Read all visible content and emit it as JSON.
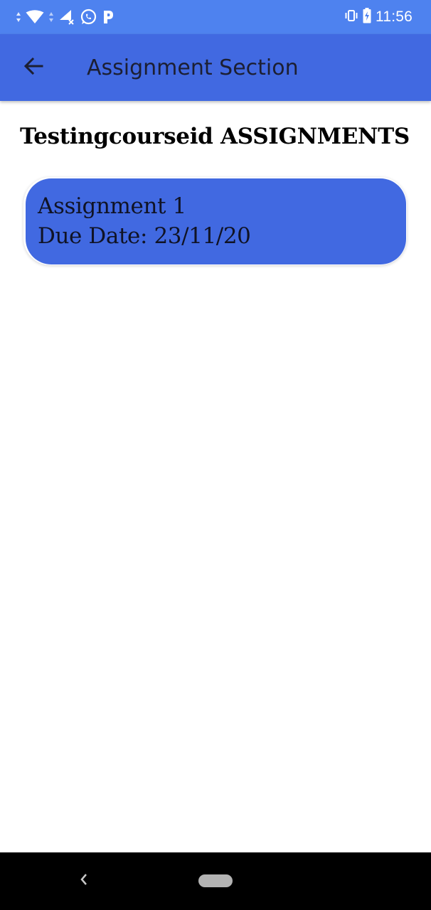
{
  "status_bar": {
    "time": "11:56",
    "left_icons": [
      "data-arrows-icon",
      "wifi-icon",
      "data-arrows-icon",
      "signal-x-icon",
      "whatsapp-icon",
      "p-icon"
    ],
    "right_icons": [
      "vibrate-icon",
      "battery-charging-icon"
    ],
    "background": "#4e82ef"
  },
  "app_bar": {
    "title": "Assignment Section",
    "back_icon": "arrow-back-icon",
    "background": "#4169e1"
  },
  "section": {
    "heading": "Testingcourseid ASSIGNMENTS"
  },
  "assignments": [
    {
      "name": "Assignment 1",
      "due": "Due Date: 23/11/20"
    }
  ],
  "nav_bar": {
    "back_icon": "chevron-left-icon",
    "home_icon": "home-pill-icon",
    "background": "#000000"
  },
  "colors": {
    "accent": "#4169e1",
    "status_bar": "#4e82ef"
  }
}
